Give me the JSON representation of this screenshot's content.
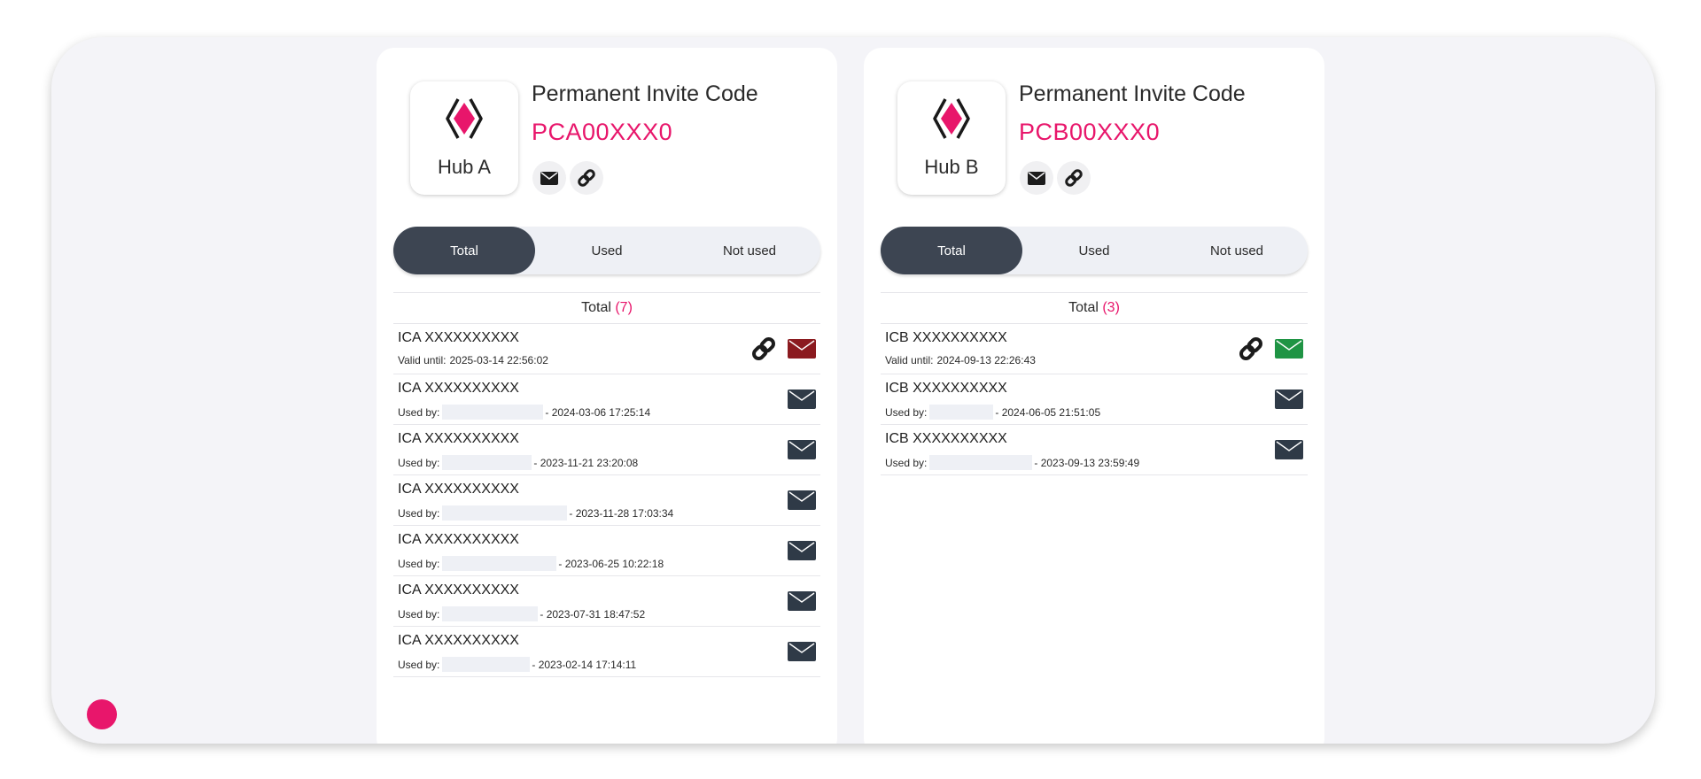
{
  "colors": {
    "accent": "#e8166b",
    "segment_active": "#3d4552",
    "mail_default": "#2f3a47",
    "mail_red": "#8b1a1f",
    "mail_green": "#1f9444"
  },
  "hubs": [
    {
      "name": "Hub A",
      "perm_title": "Permanent Invite Code",
      "perm_code": "PCA00XXX0",
      "tabs": [
        "Total",
        "Used",
        "Not used"
      ],
      "active_tab": "Total",
      "list_title": "Total",
      "list_count": "(7)",
      "rows": [
        {
          "code": "ICA XXXXXXXXXX",
          "prefix": "Valid until:",
          "value": "2025-03-14 22:56:02",
          "has_link": true,
          "mail_color": "red"
        },
        {
          "code": "ICA XXXXXXXXXX",
          "prefix": "Used by:",
          "value": "- 2024-03-06 17:25:14",
          "redact": 0.6,
          "mail_color": "default"
        },
        {
          "code": "ICA XXXXXXXXXX",
          "prefix": "Used by:",
          "value": "- 2023-11-21 23:20:08",
          "redact": 0.53,
          "mail_color": "default"
        },
        {
          "code": "ICA XXXXXXXXXX",
          "prefix": "Used by:",
          "value": "- 2023-11-28 17:03:34",
          "redact": 0.74,
          "mail_color": "default"
        },
        {
          "code": "ICA XXXXXXXXXX",
          "prefix": "Used by:",
          "value": "- 2023-06-25 10:22:18",
          "redact": 0.68,
          "mail_color": "default"
        },
        {
          "code": "ICA XXXXXXXXXX",
          "prefix": "Used by:",
          "value": "- 2023-07-31 18:47:52",
          "redact": 0.57,
          "mail_color": "default"
        },
        {
          "code": "ICA XXXXXXXXXX",
          "prefix": "Used by:",
          "value": "- 2023-02-14 17:14:11",
          "redact": 0.52,
          "mail_color": "default"
        }
      ]
    },
    {
      "name": "Hub B",
      "perm_title": "Permanent Invite Code",
      "perm_code": "PCB00XXX0",
      "tabs": [
        "Total",
        "Used",
        "Not used"
      ],
      "active_tab": "Total",
      "list_title": "Total",
      "list_count": "(3)",
      "rows": [
        {
          "code": "ICB XXXXXXXXXX",
          "prefix": "Valid until:",
          "value": "2024-09-13 22:26:43",
          "has_link": true,
          "mail_color": "green"
        },
        {
          "code": "ICB XXXXXXXXXX",
          "prefix": "Used by:",
          "value": "- 2024-06-05 21:51:05",
          "redact": 0.38,
          "mail_color": "default"
        },
        {
          "code": "ICB XXXXXXXXXX",
          "prefix": "Used by:",
          "value": "- 2023-09-13 23:59:49",
          "redact": 0.61,
          "mail_color": "default"
        }
      ]
    }
  ]
}
